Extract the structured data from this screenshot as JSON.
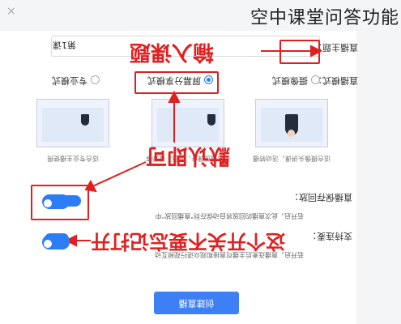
{
  "watermark": "空中课堂问答功能",
  "close_icon": "close-icon",
  "form": {
    "title_label": "直播主题：",
    "title_value": "第1课",
    "mode_label": "直播模式：",
    "modes": [
      {
        "label": "专业模式",
        "selected": false
      },
      {
        "label": "屏幕分享模式",
        "selected": true
      },
      {
        "label": "摄像模式",
        "selected": false
      }
    ],
    "card_descs": [
      "适合专业主播使用",
      "适合播放课件、网页、视频等",
      "适合摄像头讲课，活动转播"
    ],
    "record_label": "直播保存回放：",
    "record_desc": "若开启，此次直播的回放将自动保存到\"直播回放\"中",
    "support_label": "支持连麦：",
    "support_desc": "若开启，直播连麦后主播可直接和观众进行视频互动",
    "create_button": "创建直播"
  },
  "annotations": {
    "input_topic": "输入课题",
    "default_ok": "默认即可",
    "remember": "这个开关不要忘记打开"
  },
  "colors": {
    "annotation": "#e02020",
    "accent": "#3d7ff5"
  }
}
